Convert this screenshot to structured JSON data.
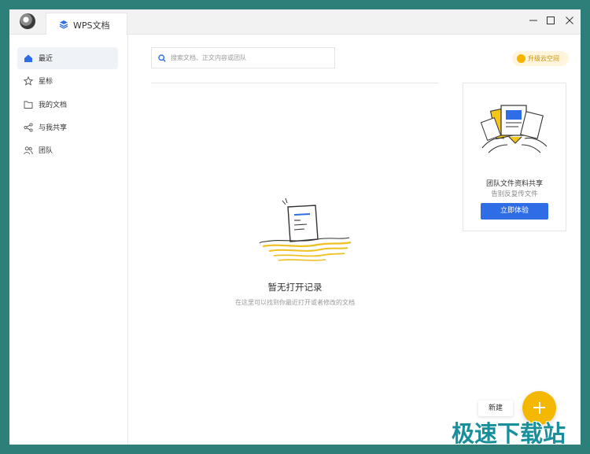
{
  "app": {
    "tab_title": "WPS文档",
    "window_controls": {
      "minimize": "—",
      "maximize": "☐",
      "close": "✕"
    }
  },
  "sidebar": {
    "items": [
      {
        "label": "最近",
        "icon": "home-icon",
        "active": true
      },
      {
        "label": "星标",
        "icon": "star-icon",
        "active": false
      },
      {
        "label": "我的文档",
        "icon": "folder-icon",
        "active": false
      },
      {
        "label": "与我共享",
        "icon": "share-icon",
        "active": false
      },
      {
        "label": "团队",
        "icon": "team-icon",
        "active": false
      }
    ]
  },
  "search": {
    "placeholder": "搜索文档、正文内容或团队",
    "value": ""
  },
  "upgrade": {
    "label": "升级云空间"
  },
  "empty_state": {
    "title": "暂无打开记录",
    "subtitle": "在这里可以找到你最近打开或者修改的文档"
  },
  "promo": {
    "title": "团队文件资料共享",
    "subtitle": "告别反复传文件",
    "button_label": "立即体验"
  },
  "new_button": {
    "label": "新建",
    "icon": "plus-icon"
  },
  "watermark": {
    "text": "极速下载站"
  },
  "colors": {
    "accent": "#2e6de6",
    "fab": "#f5b800",
    "frame": "#2d7f7a"
  }
}
